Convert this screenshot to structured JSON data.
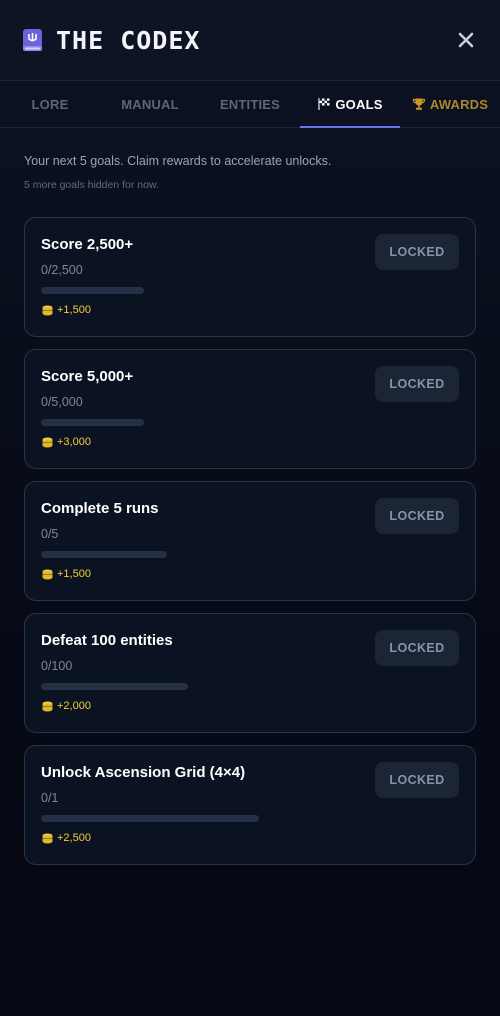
{
  "app": {
    "title": "THE CODEX"
  },
  "tabs": [
    {
      "label": "LORE",
      "active": false
    },
    {
      "label": "MANUAL",
      "active": false
    },
    {
      "label": "ENTITIES",
      "active": false
    },
    {
      "label": "GOALS",
      "active": true,
      "icon": "checkered-flag-icon"
    },
    {
      "label": "AWARDS",
      "active": false,
      "icon": "trophy-icon"
    }
  ],
  "intro": {
    "text": "Your next 5 goals. Claim rewards to accelerate unlocks.",
    "hidden_note": "5 more goals hidden for now."
  },
  "goals": [
    {
      "title": "Score 2,500+",
      "progress_text": "0/2,500",
      "progress": 0,
      "reward": "+1,500",
      "button": "LOCKED"
    },
    {
      "title": "Score 5,000+",
      "progress_text": "0/5,000",
      "progress": 0,
      "reward": "+3,000",
      "button": "LOCKED"
    },
    {
      "title": "Complete 5 runs",
      "progress_text": "0/5",
      "progress": 0,
      "reward": "+1,500",
      "button": "LOCKED"
    },
    {
      "title": "Defeat 100 entities",
      "progress_text": "0/100",
      "progress": 0,
      "reward": "+2,000",
      "button": "LOCKED"
    },
    {
      "title": "Unlock Ascension Grid (4×4)",
      "progress_text": "0/1",
      "progress": 0,
      "reward": "+2,500",
      "button": "LOCKED"
    }
  ],
  "colors": {
    "accent": "#6b73e8",
    "reward": "#f2cd3c",
    "awards_tab": "#a8882c",
    "background": "#070b17"
  }
}
